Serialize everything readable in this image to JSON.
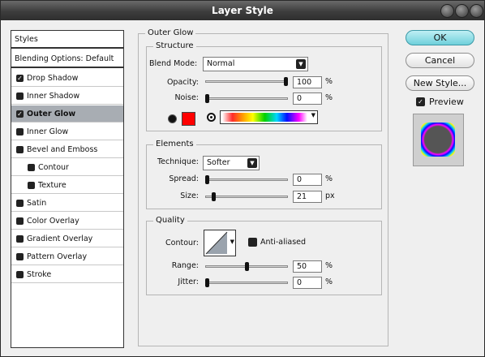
{
  "window": {
    "title": "Layer Style"
  },
  "styles_panel": {
    "header": "Styles",
    "blending": "Blending Options: Default",
    "items": [
      {
        "label": "Drop Shadow",
        "checked": true,
        "selected": false,
        "indent": false
      },
      {
        "label": "Inner Shadow",
        "checked": false,
        "selected": false,
        "indent": false
      },
      {
        "label": "Outer Glow",
        "checked": true,
        "selected": true,
        "indent": false
      },
      {
        "label": "Inner Glow",
        "checked": false,
        "selected": false,
        "indent": false
      },
      {
        "label": "Bevel and Emboss",
        "checked": false,
        "selected": false,
        "indent": false
      },
      {
        "label": "Contour",
        "checked": false,
        "selected": false,
        "indent": true
      },
      {
        "label": "Texture",
        "checked": false,
        "selected": false,
        "indent": true
      },
      {
        "label": "Satin",
        "checked": false,
        "selected": false,
        "indent": false
      },
      {
        "label": "Color Overlay",
        "checked": false,
        "selected": false,
        "indent": false
      },
      {
        "label": "Gradient Overlay",
        "checked": false,
        "selected": false,
        "indent": false
      },
      {
        "label": "Pattern Overlay",
        "checked": false,
        "selected": false,
        "indent": false
      },
      {
        "label": "Stroke",
        "checked": false,
        "selected": false,
        "indent": false
      }
    ]
  },
  "outer_glow": {
    "title": "Outer Glow",
    "structure": {
      "title": "Structure",
      "blend_mode_label": "Blend Mode:",
      "blend_mode": "Normal",
      "opacity_label": "Opacity:",
      "opacity": "100",
      "opacity_level": 1.0,
      "noise_label": "Noise:",
      "noise": "0",
      "noise_level": 0.0,
      "percent": "%",
      "color": "#ff0000"
    },
    "elements": {
      "title": "Elements",
      "technique_label": "Technique:",
      "technique": "Softer",
      "spread_label": "Spread:",
      "spread": "0",
      "spread_level": 0.0,
      "size_label": "Size:",
      "size": "21",
      "size_level": 0.084,
      "percent": "%",
      "px": "px"
    },
    "quality": {
      "title": "Quality",
      "contour_label": "Contour:",
      "anti_aliased_label": "Anti-aliased",
      "range_label": "Range:",
      "range": "50",
      "range_level": 0.5,
      "jitter_label": "Jitter:",
      "jitter": "0",
      "jitter_level": 0.0,
      "percent": "%"
    }
  },
  "buttons": {
    "ok": "OK",
    "cancel": "Cancel",
    "new_style": "New Style...",
    "preview_label": "Preview",
    "preview_checked": true
  },
  "colors": {
    "ok_accent": "#6fd0db",
    "selection": "#a8adb3"
  }
}
